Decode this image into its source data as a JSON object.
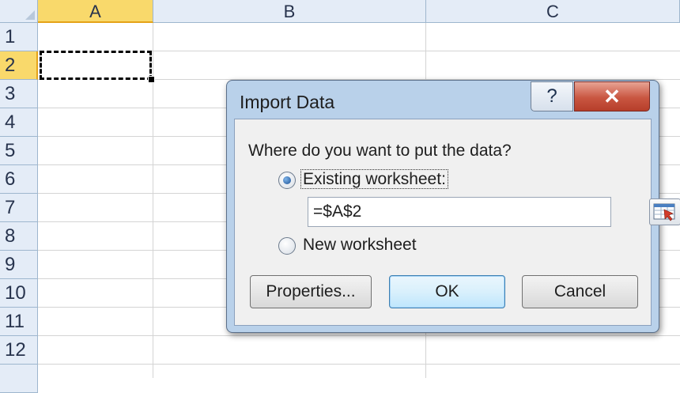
{
  "sheet": {
    "columns": [
      "A",
      "B",
      "C"
    ],
    "rows": [
      "1",
      "2",
      "3",
      "4",
      "5",
      "6",
      "7",
      "8",
      "9",
      "10",
      "11",
      "12"
    ],
    "active_column": "A",
    "active_row": "2"
  },
  "dialog": {
    "title": "Import Data",
    "help_label": "?",
    "close_label": "✕",
    "question": "Where do you want to put the data?",
    "existing_worksheet_label": "Existing worksheet:",
    "existing_selected": true,
    "reference_value": "=$A$2",
    "new_worksheet_label": "New worksheet",
    "properties_label": "Properties...",
    "ok_label": "OK",
    "cancel_label": "Cancel"
  },
  "icons": {
    "range_selector": "collapse-dialog-icon",
    "help": "question-mark-icon",
    "close": "close-icon"
  },
  "colors": {
    "header_active": "#f9d96b",
    "dialog_frame": "#b9d1ea",
    "close_button": "#c95641"
  }
}
